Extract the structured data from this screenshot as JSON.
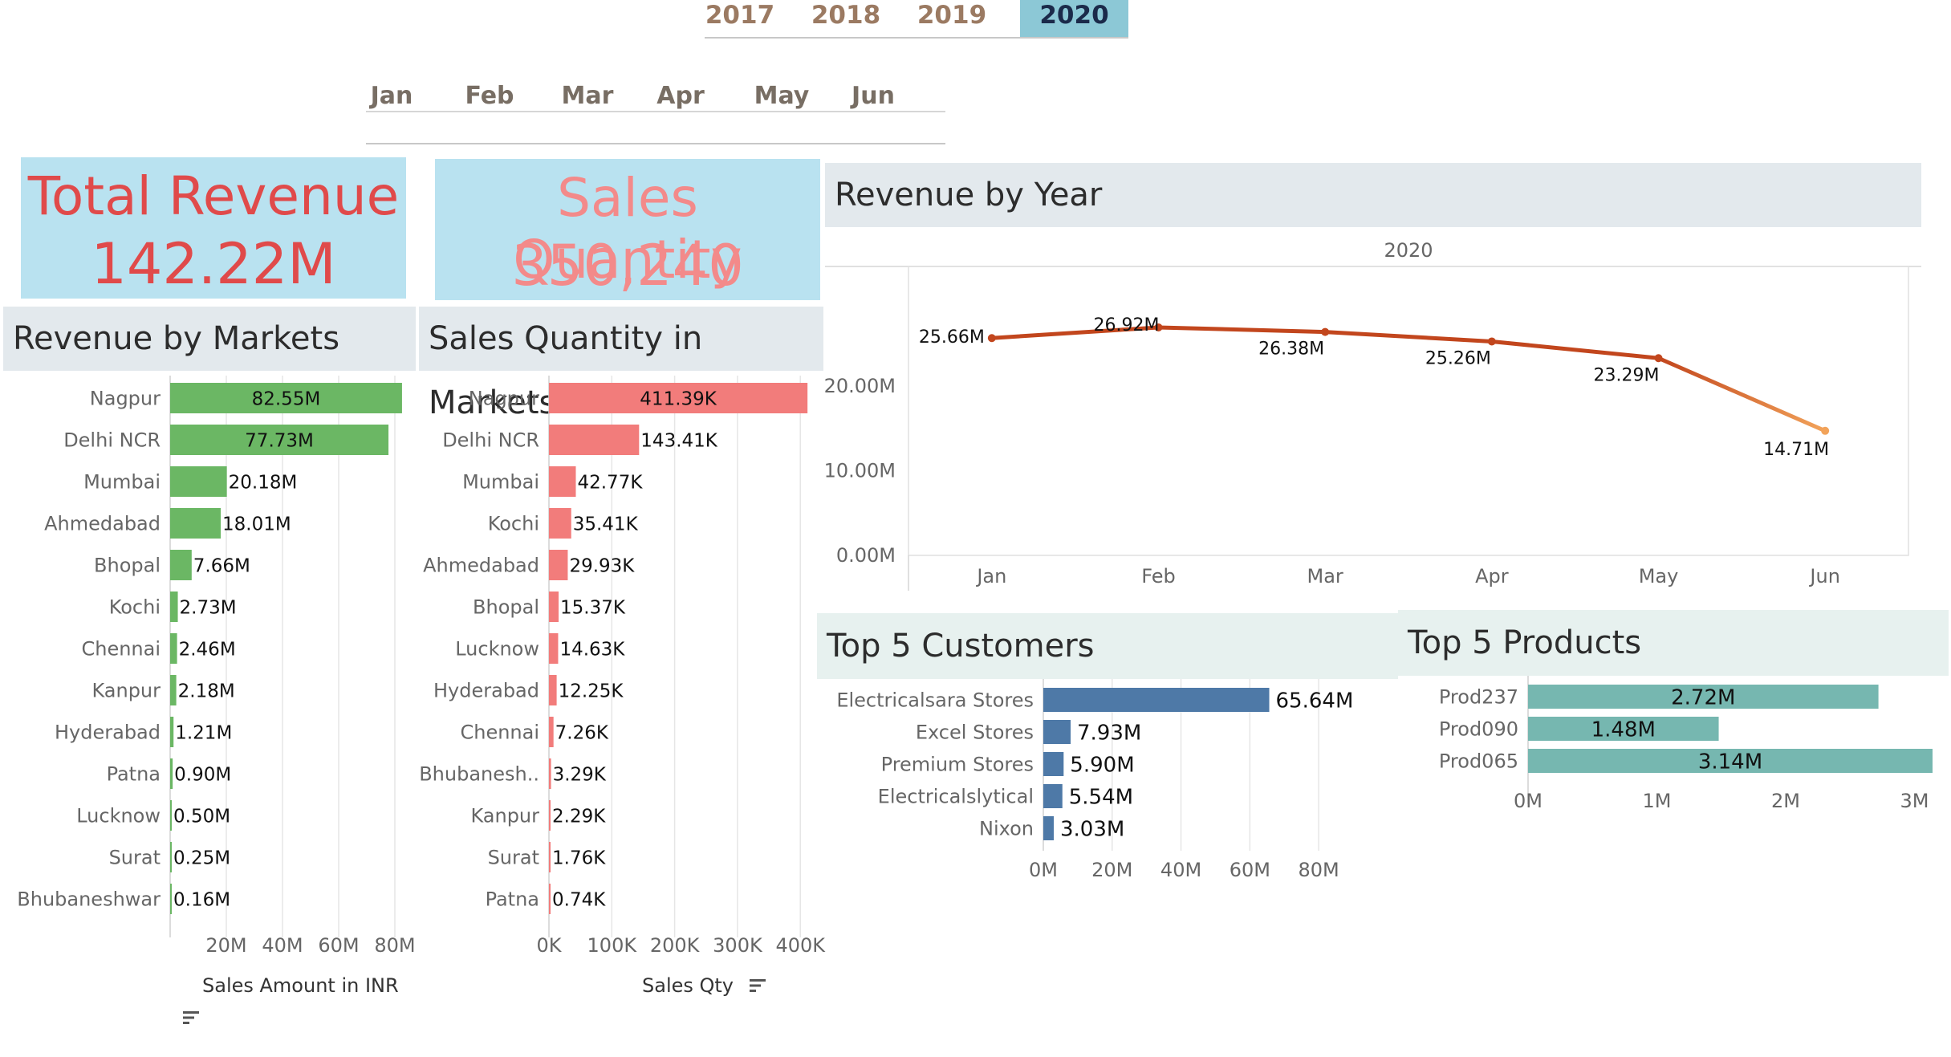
{
  "year_filter": {
    "items": [
      {
        "label": "2017",
        "active": false
      },
      {
        "label": "2018",
        "active": false
      },
      {
        "label": "2019",
        "active": false
      },
      {
        "label": "2020",
        "active": true
      }
    ]
  },
  "month_filter": {
    "items": [
      "Jan",
      "Feb",
      "Mar",
      "Apr",
      "May",
      "Jun"
    ]
  },
  "kpis": {
    "total_revenue": {
      "label": "Total Revenue",
      "value": "142.22M",
      "color": "#e04a4a"
    },
    "sales_quantity": {
      "label": "Sales Quantity",
      "value": "350,240",
      "color": "#f38a8a"
    }
  },
  "titles": {
    "revenue_by_markets": "Revenue by Markets",
    "sales_qty_markets": "Sales Quantity in Markets",
    "revenue_by_year": "Revenue by Year",
    "top_customers": "Top 5 Customers",
    "top_products": "Top 5 Products"
  },
  "colors": {
    "green": "#6bb764",
    "red": "#f27c7b",
    "blue": "#4e79a7",
    "teal": "#76b7b0",
    "line_main": "#c2461d",
    "line_fade": "#f2a35a"
  },
  "chart_data": [
    {
      "type": "bar",
      "orientation": "horizontal",
      "categories": [
        "Nagpur",
        "Delhi NCR",
        "Mumbai",
        "Ahmedabad",
        "Bhopal",
        "Kochi",
        "Chennai",
        "Kanpur",
        "Hyderabad",
        "Patna",
        "Lucknow",
        "Surat",
        "Bhubaneshwar"
      ],
      "values": [
        82.55,
        77.73,
        20.18,
        18.01,
        7.66,
        2.73,
        2.46,
        2.18,
        1.21,
        0.9,
        0.5,
        0.25,
        0.16
      ],
      "labels": [
        "82.55M",
        "77.73M",
        "20.18M",
        "18.01M",
        "7.66M",
        "2.73M",
        "2.46M",
        "2.18M",
        "1.21M",
        "0.90M",
        "0.50M",
        "0.25M",
        "0.16M"
      ],
      "xticks": [
        "20M",
        "40M",
        "60M",
        "80M"
      ],
      "xtick_values": [
        20,
        40,
        60,
        80
      ],
      "xlim": [
        0,
        84
      ],
      "xlabel": "Sales Amount in INR",
      "grid": true
    },
    {
      "type": "bar",
      "orientation": "horizontal",
      "categories": [
        "Nagpur",
        "Delhi NCR",
        "Mumbai",
        "Kochi",
        "Ahmedabad",
        "Bhopal",
        "Lucknow",
        "Hyderabad",
        "Chennai",
        "Bhubanesh..",
        "Kanpur",
        "Surat",
        "Patna"
      ],
      "values": [
        411.39,
        143.41,
        42.77,
        35.41,
        29.93,
        15.37,
        14.63,
        12.25,
        7.26,
        3.29,
        2.29,
        1.76,
        0.74
      ],
      "labels": [
        "411.39K",
        "143.41K",
        "42.77K",
        "35.41K",
        "29.93K",
        "15.37K",
        "14.63K",
        "12.25K",
        "7.26K",
        "3.29K",
        "2.29K",
        "1.76K",
        "0.74K"
      ],
      "xticks": [
        "0K",
        "100K",
        "200K",
        "300K",
        "400K"
      ],
      "xtick_values": [
        0,
        100,
        200,
        300,
        400
      ],
      "xlim": [
        0,
        415
      ],
      "xlabel": "Sales Qty",
      "grid": true
    },
    {
      "type": "line",
      "header": "2020",
      "x": [
        "Jan",
        "Feb",
        "Mar",
        "Apr",
        "May",
        "Jun"
      ],
      "values": [
        25.66,
        26.92,
        26.38,
        25.26,
        23.29,
        14.71
      ],
      "labels": [
        "25.66M",
        "26.92M",
        "26.38M",
        "25.26M",
        "23.29M",
        "14.71M"
      ],
      "yticks": [
        "0.00M",
        "10.00M",
        "20.00M"
      ],
      "ytick_values": [
        0,
        10,
        20
      ],
      "ylim": [
        0,
        29
      ],
      "grid": false
    },
    {
      "type": "bar",
      "orientation": "horizontal",
      "categories": [
        "Electricalsara Stores",
        "Excel Stores",
        "Premium Stores",
        "Electricalslytical",
        "Nixon"
      ],
      "values": [
        65.64,
        7.93,
        5.9,
        5.54,
        3.03
      ],
      "labels": [
        "65.64M",
        "7.93M",
        "5.90M",
        "5.54M",
        "3.03M"
      ],
      "xticks": [
        "0M",
        "20M",
        "40M",
        "60M",
        "80M"
      ],
      "xtick_values": [
        0,
        20,
        40,
        60,
        80
      ],
      "xlim": [
        0,
        90
      ],
      "grid": true
    },
    {
      "type": "bar",
      "orientation": "horizontal",
      "categories": [
        "Prod237",
        "Prod090",
        "Prod065"
      ],
      "values": [
        2.72,
        1.48,
        3.14
      ],
      "labels": [
        "2.72M",
        "1.48M",
        "3.14M"
      ],
      "xticks": [
        "0M",
        "1M",
        "2M",
        "3M"
      ],
      "xtick_values": [
        0,
        1,
        2,
        3
      ],
      "xlim": [
        0,
        3.14
      ],
      "grid": false
    }
  ]
}
